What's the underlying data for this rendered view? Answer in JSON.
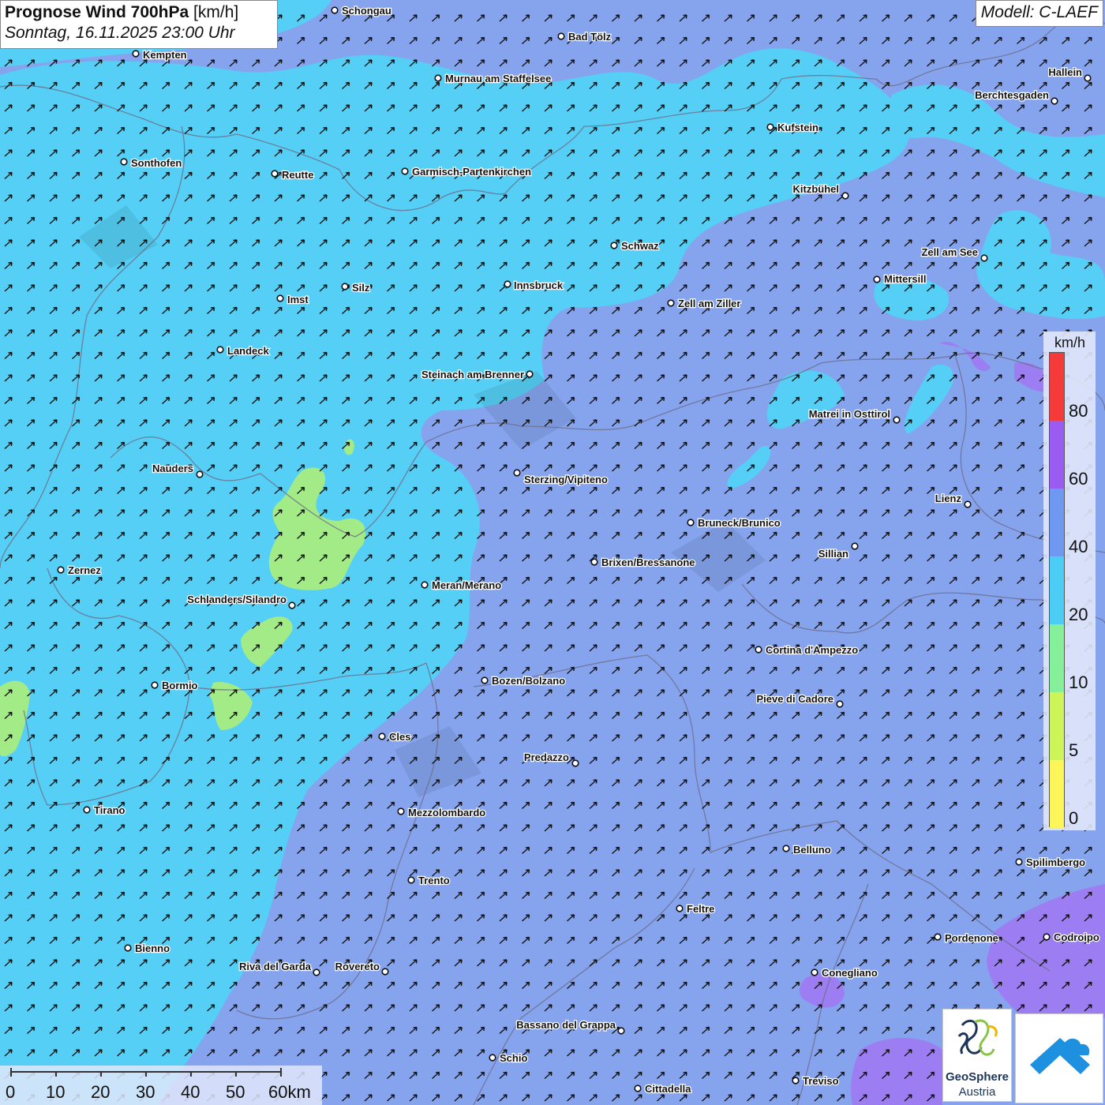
{
  "title": {
    "main": "Prognose Wind 700hPa",
    "unit": "[km/h]",
    "datetime": "Sonntag, 16.11.2025 23:00 Uhr",
    "model": "Modell: C-LAEF"
  },
  "legend": {
    "unit": "km/h",
    "classes": [
      {
        "from": 0,
        "to": 5,
        "color": "#fdf65a"
      },
      {
        "from": 5,
        "to": 10,
        "color": "#cdf55a"
      },
      {
        "from": 10,
        "to": 20,
        "color": "#86ef9a"
      },
      {
        "from": 20,
        "to": 40,
        "color": "#4ccdf5"
      },
      {
        "from": 40,
        "to": 60,
        "color": "#6e98f2"
      },
      {
        "from": 60,
        "to": 80,
        "color": "#9a5cf0"
      },
      {
        "from": 80,
        "to": 100,
        "color": "#f53a3a"
      }
    ],
    "labels": [
      "80",
      "60",
      "40",
      "20",
      "10",
      "5",
      "0"
    ]
  },
  "scalebar": {
    "labels": [
      "0",
      "10",
      "20",
      "30",
      "40",
      "50",
      "60km"
    ]
  },
  "logos": {
    "geosphere_line1": "GeoSphere",
    "geosphere_line2": "Austria",
    "geosphere_icon": "geosphere-logo-icon",
    "app_icon": "wetter-app-logo-icon"
  },
  "map": {
    "wind_direction": "south-west to north-east",
    "cities": [
      "Schongau",
      "Bad Tölz",
      "Kempten",
      "Murnau am Staffelsee",
      "Hallein",
      "Berchtesgaden",
      "Kufstein",
      "Sonthofen",
      "Reutte",
      "Garmisch-Partenkirchen",
      "Kitzbühel",
      "Schwaz",
      "Zell am See",
      "Mittersill",
      "Innsbruck",
      "Imst",
      "Silz",
      "Zell am Ziller",
      "Landeck",
      "Steinach am Brenner",
      "Matrei in Osttirol",
      "Nauders",
      "Sterzing/Vipiteno",
      "Lienz",
      "Bruneck/Brunico",
      "Sillian",
      "Brixen/Bressanone",
      "Zernez",
      "Meran/Merano",
      "Schlanders/Silandro",
      "Cortina d'Ampezzo",
      "Bormio",
      "Bozen/Bolzano",
      "Pieve di Cadore",
      "Cles",
      "Predazzo",
      "Tirano",
      "Mezzolombardo",
      "Belluno",
      "Spilimbergo",
      "Trento",
      "Feltre",
      "Pordenone",
      "Codroipo",
      "Bienno",
      "Riva del Garda",
      "Rovereto",
      "Conegliano",
      "Bassano del Grappa",
      "Schio",
      "Treviso",
      "Cittadella"
    ]
  }
}
